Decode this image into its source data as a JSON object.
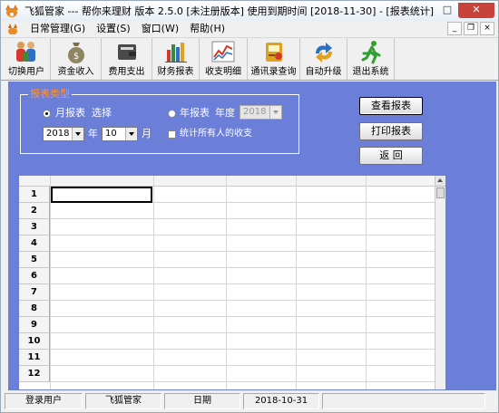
{
  "window": {
    "title": "飞狐管家 --- 帮你来理财      版本 2.5.0 [未注册版本]  使用到期时间 [2018-11-30] - [报表统计]",
    "minimize": "—",
    "maximize": "□",
    "close": "✕"
  },
  "menu": {
    "items": [
      "日常管理(G)",
      "设置(S)",
      "窗口(W)",
      "帮助(H)"
    ],
    "mdi_minimize": "_",
    "mdi_restore": "❐",
    "mdi_close": "×"
  },
  "toolbar": {
    "items": [
      {
        "label": "切换用户",
        "icon": "users-icon"
      },
      {
        "label": "资金收入",
        "icon": "money-bag-icon"
      },
      {
        "label": "费用支出",
        "icon": "wallet-icon"
      },
      {
        "label": "财务报表",
        "icon": "bar-chart-icon"
      },
      {
        "label": "收支明细",
        "icon": "line-chart-icon"
      },
      {
        "label": "通讯录查询",
        "icon": "contact-book-icon"
      },
      {
        "label": "自动升级",
        "icon": "upgrade-icon"
      },
      {
        "label": "退出系统",
        "icon": "exit-runner-icon"
      }
    ]
  },
  "report": {
    "group_title": "报表类型",
    "monthly_label": "月报表",
    "select_label": "选择",
    "yearly_label": "年报表",
    "year_label": "年度",
    "yearly_year_value": "2018",
    "year_value": "2018",
    "year_unit": "年",
    "month_value": "10",
    "month_unit": "月",
    "all_people_label": "统计所有人的收支",
    "monthly_selected": true,
    "all_people_checked": false
  },
  "buttons": {
    "view": "查看报表",
    "print": "打印报表",
    "back": "返 回"
  },
  "grid": {
    "rows": [
      "1",
      "2",
      "3",
      "4",
      "5",
      "6",
      "7",
      "8",
      "9",
      "10",
      "11",
      "12"
    ]
  },
  "status": {
    "cells": [
      "登录用户",
      "飞狐管家",
      "日期",
      "2018-10-31",
      ""
    ]
  },
  "colors": {
    "content_bg": "#6c7fd8",
    "group_title": "#ff9230"
  }
}
